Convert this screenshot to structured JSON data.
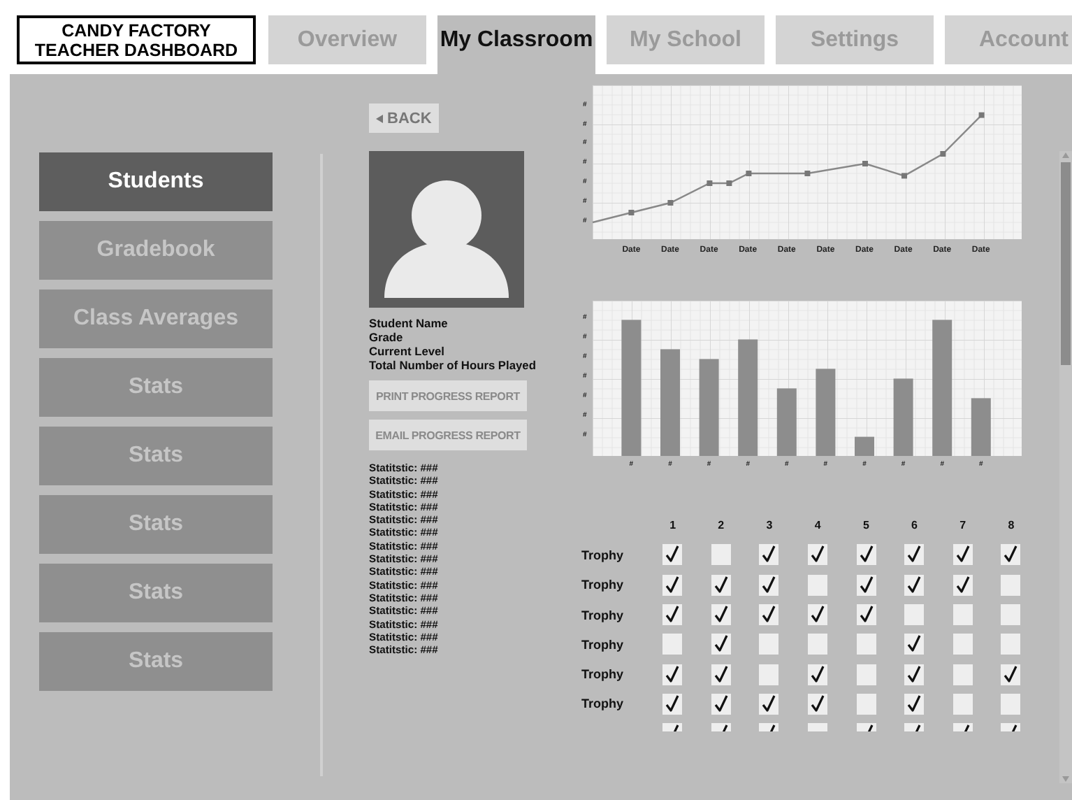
{
  "header": {
    "logo": [
      "CANDY FACTORY",
      "TEACHER DASHBOARD"
    ]
  },
  "tabs": [
    {
      "label": "Overview",
      "selected": false
    },
    {
      "label": "My Classroom",
      "selected": true
    },
    {
      "label": "My School",
      "selected": false
    },
    {
      "label": "Settings",
      "selected": false
    },
    {
      "label": "Account",
      "selected": false
    }
  ],
  "sidebar": {
    "items": [
      {
        "label": "Students",
        "selected": true
      },
      {
        "label": "Gradebook",
        "selected": false
      },
      {
        "label": "Class Averages",
        "selected": false
      },
      {
        "label": "Stats",
        "selected": false
      },
      {
        "label": "Stats",
        "selected": false
      },
      {
        "label": "Stats",
        "selected": false
      },
      {
        "label": "Stats",
        "selected": false
      },
      {
        "label": "Stats",
        "selected": false
      }
    ]
  },
  "student": {
    "back": "BACK",
    "fields": [
      "Student Name",
      "Grade",
      "Current Level",
      "Total Number of Hours Played"
    ],
    "buttons": [
      "PRINT PROGRESS REPORT",
      "EMAIL PROGRESS REPORT"
    ],
    "stats": [
      "Statitstic: ###",
      "Statitstic: ###",
      "Statitstic: ###",
      "Statitstic: ###",
      "Statitstic: ###",
      "Statitstic: ###",
      "Statitstic: ###",
      "Statitstic: ###",
      "Statitstic: ###",
      "Statitstic: ###",
      "Statitstic: ###",
      "Statitstic: ###",
      "Statitstic: ###",
      "Statitstic: ###",
      "Statitstic: ###"
    ]
  },
  "line_chart": {
    "y_labels": [
      "#",
      "#",
      "#",
      "#",
      "#",
      "#",
      "#"
    ],
    "x_labels": [
      "Date",
      "Date",
      "Date",
      "Date",
      "Date",
      "Date",
      "Date",
      "Date",
      "Date",
      "Date"
    ]
  },
  "bar_chart": {
    "y_labels": [
      "#",
      "#",
      "#",
      "#",
      "#",
      "#",
      "#"
    ],
    "x_labels": [
      "#",
      "#",
      "#",
      "#",
      "#",
      "#",
      "#",
      "#",
      "#",
      "#"
    ]
  },
  "trophies": {
    "columns": [
      "1",
      "2",
      "3",
      "4",
      "5",
      "6",
      "7",
      "8"
    ],
    "rows": [
      {
        "label": "Trophy",
        "checks": [
          true,
          false,
          true,
          true,
          true,
          true,
          true,
          true
        ]
      },
      {
        "label": "Trophy",
        "checks": [
          true,
          true,
          true,
          false,
          true,
          true,
          true,
          false
        ]
      },
      {
        "label": "Trophy",
        "checks": [
          true,
          true,
          true,
          true,
          true,
          false,
          false,
          false
        ]
      },
      {
        "label": "Trophy",
        "checks": [
          false,
          true,
          false,
          false,
          false,
          true,
          false,
          false
        ]
      },
      {
        "label": "Trophy",
        "checks": [
          true,
          true,
          false,
          true,
          false,
          true,
          false,
          true
        ]
      },
      {
        "label": "Trophy",
        "checks": [
          true,
          true,
          true,
          true,
          false,
          true,
          false,
          false
        ]
      },
      {
        "checks": [
          true,
          true,
          true,
          false,
          true,
          true,
          true,
          true
        ]
      }
    ]
  }
}
